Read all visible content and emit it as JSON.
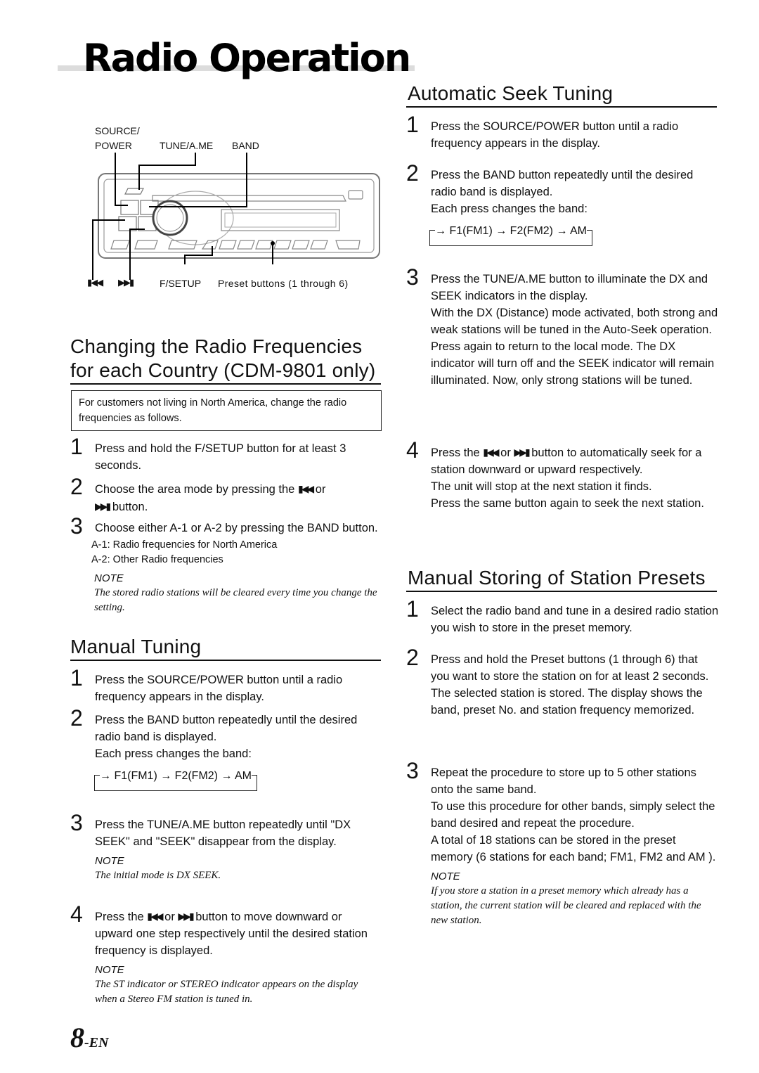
{
  "page": {
    "title": "Radio Operation",
    "page_number": "8",
    "page_suffix": "-EN"
  },
  "diagram": {
    "labels": {
      "source": "SOURCE/",
      "power": "POWER",
      "tune": "TUNE/A.ME",
      "band": "BAND",
      "prev_icon": "⏮",
      "next_icon": "⏭",
      "fsetup": "F/SETUP",
      "presets": "Preset buttons (1 through 6)"
    }
  },
  "icons": {
    "prev": "▮◀◀",
    "next": "▶▶▮"
  },
  "left": {
    "country": {
      "heading_line1": "Changing the Radio Frequencies",
      "heading_line2": "for each Country (CDM-9801 only)",
      "callout": "For customers not living in North America, change the radio frequencies as follows.",
      "steps": [
        {
          "num": "1",
          "text": "Press and hold the F/SETUP button for at least 3 seconds."
        },
        {
          "num": "2",
          "text_before": "Choose the area mode by pressing the",
          "text_or": "or",
          "text_after": "button."
        },
        {
          "num": "3",
          "text": "Choose either A-1 or A-2 by pressing the BAND button.",
          "sub": [
            "A-1: Radio frequencies for North America",
            "A-2: Other Radio frequencies"
          ]
        }
      ],
      "note_label": "NOTE",
      "note": "The stored radio stations will be cleared every time you change the setting."
    },
    "manual": {
      "heading": "Manual Tuning",
      "steps": [
        {
          "num": "1",
          "text": "Press the SOURCE/POWER button until a radio frequency appears in the display."
        },
        {
          "num": "2",
          "text": "Press the BAND button repeatedly until the desired radio band is displayed.",
          "extra": "Each press changes the band:"
        },
        {
          "num": "3",
          "text": "Press the TUNE/A.ME button repeatedly until \"DX SEEK\" and \"SEEK\" disappear from the display.",
          "note_label": "NOTE",
          "note": "The initial mode is DX SEEK."
        },
        {
          "num": "4",
          "text_before": "Press the",
          "text_or": "or",
          "text_after": "button to move downward or upward one step respectively until the desired station frequency is displayed.",
          "note_label": "NOTE",
          "note": "The ST indicator or STEREO indicator appears on the display when a Stereo FM station is tuned in."
        }
      ],
      "cycle": "→ F1(FM1) → F2(FM2) → AM"
    }
  },
  "right": {
    "auto": {
      "heading": "Automatic Seek Tuning",
      "steps": [
        {
          "num": "1",
          "text": "Press the SOURCE/POWER button until a radio frequency appears in the display."
        },
        {
          "num": "2",
          "text": "Press the BAND button repeatedly until the desired radio band is displayed.",
          "extra": "Each press changes the band:"
        },
        {
          "num": "3",
          "text": "Press the TUNE/A.ME button to illuminate the DX and SEEK indicators in the display.",
          "p2": "With the DX (Distance) mode activated, both strong and weak stations will be tuned in the Auto-Seek operation.",
          "p3": "Press again to return to the local mode. The DX indicator will turn off and the SEEK indicator will remain illuminated. Now, only strong stations will be tuned."
        },
        {
          "num": "4",
          "text_before": "Press the",
          "text_or": "or",
          "text_after": "button to automatically seek for  a station downward or upward respectively.",
          "p2": "The unit will stop at the next station it finds.",
          "p3": "Press the same button again to seek the next station."
        }
      ],
      "cycle": "→ F1(FM1) → F2(FM2) → AM"
    },
    "presets": {
      "heading": "Manual Storing of Station Presets",
      "steps": [
        {
          "num": "1",
          "text": "Select the radio band and tune in a desired radio station you wish to store in the preset memory."
        },
        {
          "num": "2",
          "text": "Press and hold the Preset buttons (1 through 6) that you want to store the station on for at least 2 seconds.",
          "p2": "The selected station is stored. The display shows the band, preset No. and station frequency memorized."
        },
        {
          "num": "3",
          "text": "Repeat the procedure to store up to 5 other stations onto the same band.",
          "p2": "To use this procedure for other bands, simply select the band desired and repeat the procedure.",
          "p3": "A total of 18 stations can be stored in the preset memory (6 stations for each band; FM1, FM2 and AM )."
        }
      ],
      "note_label": "NOTE",
      "note": "If you store a station in a preset memory which already has a station, the current station will be cleared and replaced with the new station."
    }
  }
}
